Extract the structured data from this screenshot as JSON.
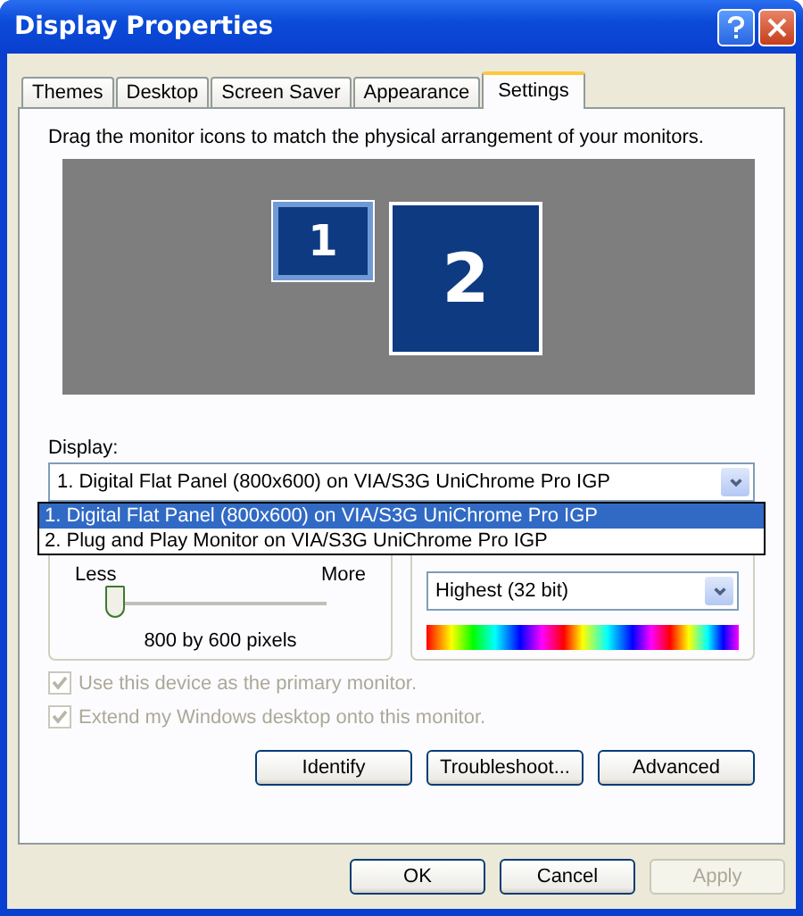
{
  "window": {
    "title": "Display Properties"
  },
  "tabs": [
    {
      "label": "Themes",
      "selected": false
    },
    {
      "label": "Desktop",
      "selected": false
    },
    {
      "label": "Screen Saver",
      "selected": false
    },
    {
      "label": "Appearance",
      "selected": false
    },
    {
      "label": "Settings",
      "selected": true
    }
  ],
  "instruction": "Drag the monitor icons to match the physical arrangement of your monitors.",
  "monitors": [
    {
      "label": "1",
      "selected": true
    },
    {
      "label": "2",
      "selected": false
    }
  ],
  "display": {
    "label": "Display:",
    "value": "1. Digital Flat Panel (800x600) on VIA/S3G UniChrome Pro IGP",
    "options": [
      {
        "label": "1. Digital Flat Panel (800x600) on VIA/S3G UniChrome Pro IGP",
        "selected": true
      },
      {
        "label": "2. Plug and Play Monitor on VIA/S3G UniChrome Pro IGP",
        "selected": false
      }
    ]
  },
  "resolution": {
    "less": "Less",
    "more": "More",
    "level": 0,
    "reading": "800 by 600 pixels"
  },
  "color_quality": {
    "value": "Highest (32 bit)"
  },
  "checkboxes": [
    {
      "label": "Use this device as the primary monitor.",
      "checked": true,
      "disabled": true
    },
    {
      "label": "Extend my Windows desktop onto this monitor.",
      "checked": true,
      "disabled": true
    }
  ],
  "panel_buttons": [
    "Identify",
    "Troubleshoot...",
    "Advanced"
  ],
  "dialog_buttons": [
    {
      "label": "OK",
      "disabled": false
    },
    {
      "label": "Cancel",
      "disabled": false
    },
    {
      "label": "Apply",
      "disabled": true
    }
  ]
}
